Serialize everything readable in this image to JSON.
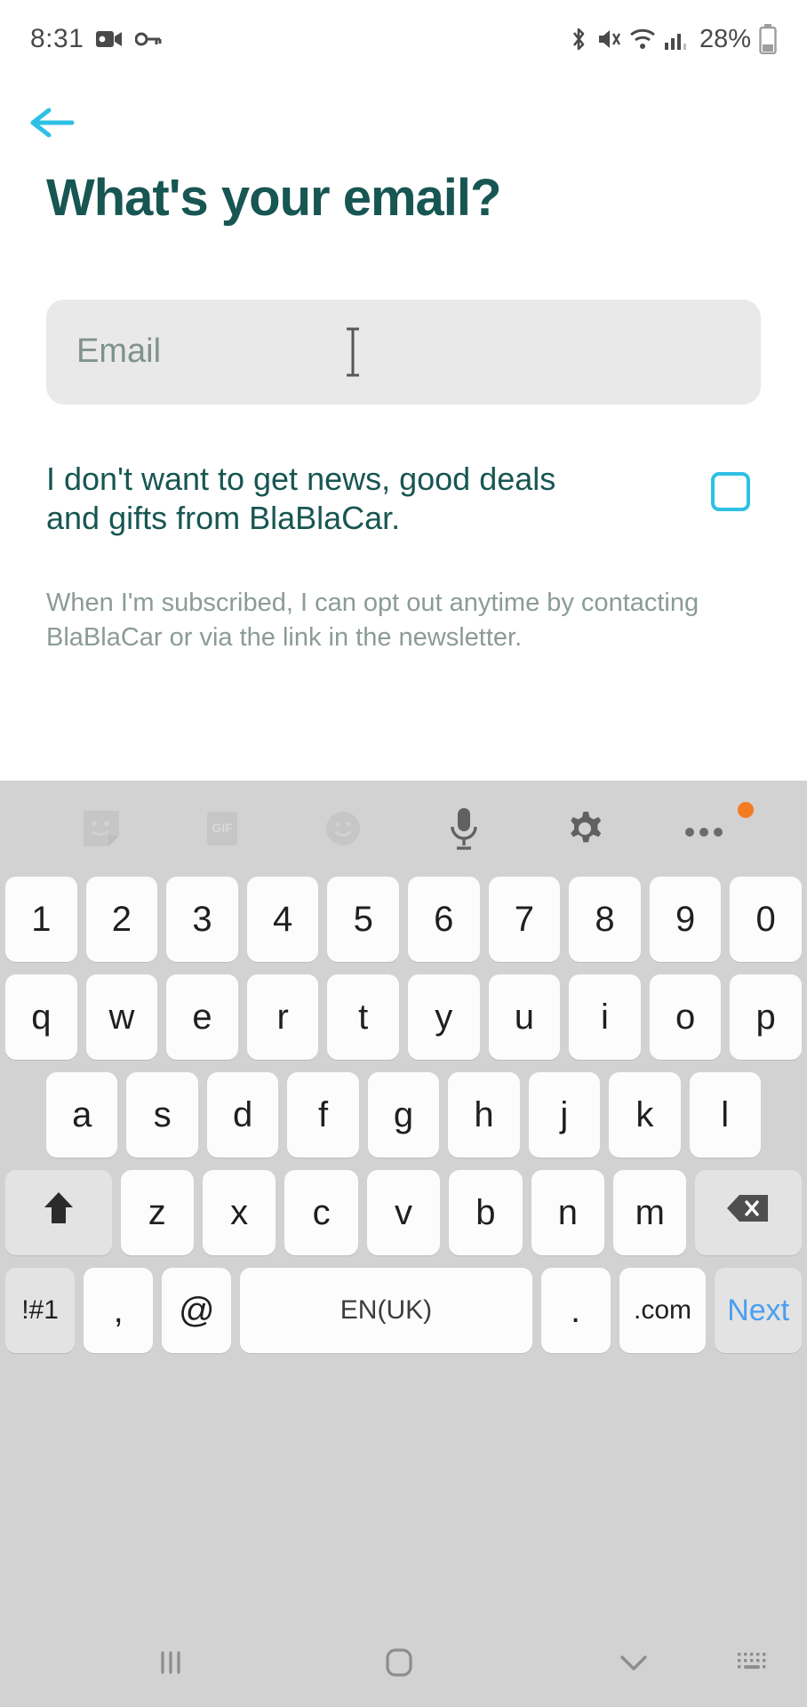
{
  "status_bar": {
    "time": "8:31",
    "battery_percent": "28%",
    "left_icons": [
      "video-camera-icon",
      "key-icon"
    ],
    "right_icons": [
      "bluetooth-icon",
      "vibrate-mute-icon",
      "wifi-icon",
      "cellular-signal-icon"
    ]
  },
  "nav": {
    "back_icon": "back-arrow-icon",
    "accent_color": "#2ec0e4"
  },
  "screen": {
    "title": "What's your email?",
    "title_color": "#175652"
  },
  "email_field": {
    "placeholder": "Email",
    "value": "",
    "background": "#e9e9e9",
    "cursor_icon": "text-caret-icon"
  },
  "optin": {
    "label": "I don't want to get news, good deals and gifts from BlaBlaCar.",
    "checked": false,
    "checkbox_color": "#2ec0e4",
    "helper": "When I'm subscribed, I can opt out anytime by contacting BlaBlaCar or via the link in the newsletter."
  },
  "keyboard": {
    "toolbar": [
      {
        "name": "sticker-icon",
        "label": ""
      },
      {
        "name": "gif-icon",
        "label": "GIF"
      },
      {
        "name": "emoji-icon",
        "label": ""
      },
      {
        "name": "microphone-icon",
        "label": ""
      },
      {
        "name": "gear-icon",
        "label": ""
      },
      {
        "name": "more-options-icon",
        "label": "",
        "badge": true
      }
    ],
    "row_numbers": [
      "1",
      "2",
      "3",
      "4",
      "5",
      "6",
      "7",
      "8",
      "9",
      "0"
    ],
    "row_top": [
      "q",
      "w",
      "e",
      "r",
      "t",
      "y",
      "u",
      "i",
      "o",
      "p"
    ],
    "row_home": [
      "a",
      "s",
      "d",
      "f",
      "g",
      "h",
      "j",
      "k",
      "l"
    ],
    "row_bottom": [
      "z",
      "x",
      "c",
      "v",
      "b",
      "n",
      "m"
    ],
    "shift_icon": "shift-arrow-icon",
    "backspace_icon": "backspace-icon",
    "symbols_key": "!#1",
    "comma_key": ",",
    "at_key": "@",
    "space_key": "EN(UK)",
    "period_key": ".",
    "dotcom_key": ".com",
    "action_key": "Next",
    "action_color": "#4a9ff0"
  },
  "system_nav": {
    "recents_icon": "recents-icon",
    "home_icon": "home-icon",
    "dismiss_keyboard_icon": "chevron-down-icon",
    "keyboard_switch_icon": "keyboard-switch-icon"
  }
}
